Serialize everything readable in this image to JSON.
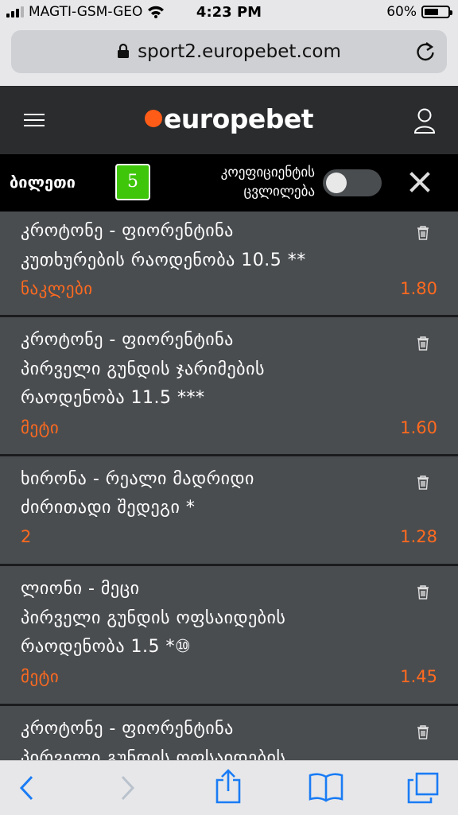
{
  "status": {
    "carrier": "MAGTI-GSM-GEO",
    "time": "4:23 PM",
    "battery": "60%",
    "battery_level": 0.6
  },
  "browser": {
    "url": "sport2.europebet.com"
  },
  "header": {
    "logo": "europebet"
  },
  "ticket": {
    "label": "ბილეთი",
    "count": "5",
    "odds_change_line1": "კოეფიციენტის",
    "odds_change_line2": "ცვლილება",
    "toggle_on": false
  },
  "bets": [
    {
      "lines": [
        "კროტონე - ფიორენტინა",
        "კუთხურების რაოდენობა 10.5 **"
      ],
      "pick": "ნაკლები",
      "odd": "1.80"
    },
    {
      "lines": [
        "კროტონე - ფიორენტინა",
        "პირველი გუნდის ჯარიმების",
        "რაოდენობა 11.5 ***"
      ],
      "pick": "მეტი",
      "odd": "1.60"
    },
    {
      "lines": [
        "ხირონა - რეალი მადრიდი",
        "ძირითადი შედეგი *"
      ],
      "pick": "2",
      "odd": "1.28"
    },
    {
      "lines": [
        "ლიონი - მეცი",
        "პირველი გუნდის ოფსაიდების",
        "რაოდენობა 1.5  *⑩"
      ],
      "pick": "მეტი",
      "odd": "1.45"
    },
    {
      "lines": [
        "კროტონე - ფიორენტინა",
        "პირველი გუნდის ოფსაიდების"
      ],
      "pick": "",
      "odd": ""
    }
  ],
  "colors": {
    "accent": "#ff6a1f",
    "count_badge": "#3fc60b",
    "header_bg": "#2a2c2e",
    "bet_bg": "#4a4d50"
  },
  "toolbar": {
    "icons": [
      "back-icon",
      "forward-icon",
      "share-icon",
      "bookmarks-icon",
      "tabs-icon"
    ]
  }
}
